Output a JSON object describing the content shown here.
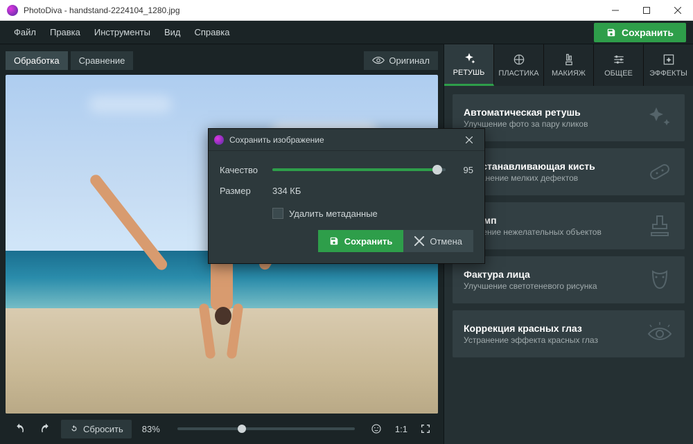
{
  "window": {
    "app_name": "PhotoDiva",
    "file_name": "handstand-2224104_1280.jpg"
  },
  "menu": {
    "file": "Файл",
    "edit": "Правка",
    "tools": "Инструменты",
    "view": "Вид",
    "help": "Справка"
  },
  "save_button": "Сохранить",
  "left_tabs": {
    "processing": "Обработка",
    "compare": "Сравнение",
    "original": "Оригинал"
  },
  "bottombar": {
    "reset": "Сбросить",
    "zoom": "83%",
    "ratio": "1:1"
  },
  "right_tabs": {
    "retouch": "РЕТУШЬ",
    "plastic": "ПЛАСТИКА",
    "makeup": "МАКИЯЖ",
    "general": "ОБЩЕЕ",
    "effects": "ЭФФЕКТЫ"
  },
  "cards": [
    {
      "title": "Автоматическая ретушь",
      "subtitle": "Улучшение фото за пару кликов"
    },
    {
      "title": "Восстанавливающая кисть",
      "subtitle": "Устранение мелких дефектов"
    },
    {
      "title": "Штамп",
      "subtitle": "Удаление нежелательных объектов"
    },
    {
      "title": "Фактура лица",
      "subtitle": "Улучшение светотеневого рисунка"
    },
    {
      "title": "Коррекция красных глаз",
      "subtitle": "Устранение эффекта красных глаз"
    }
  ],
  "modal": {
    "title": "Сохранить изображение",
    "quality_label": "Качество",
    "quality_value": "95",
    "size_label": "Размер",
    "size_value": "334 КБ",
    "delete_metadata": "Удалить метаданные",
    "save": "Сохранить",
    "cancel": "Отмена"
  }
}
